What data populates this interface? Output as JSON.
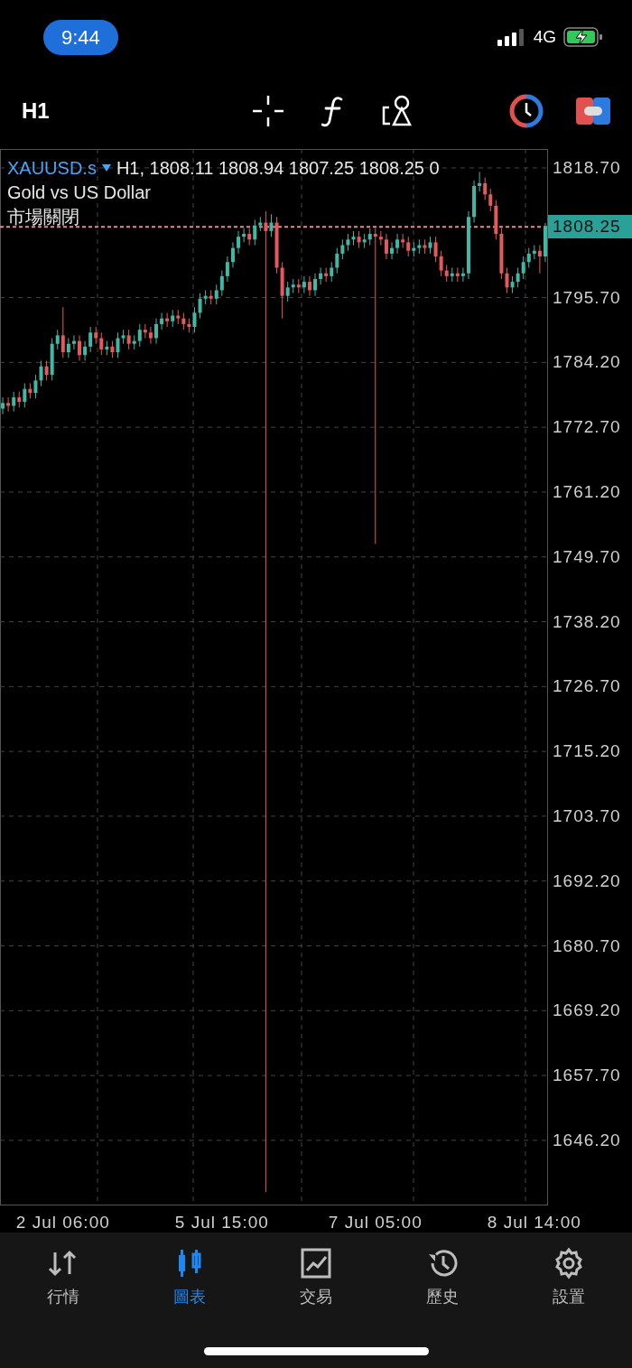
{
  "status_bar": {
    "time": "9:44",
    "network": "4G"
  },
  "toolbar": {
    "timeframe": "H1"
  },
  "chart": {
    "symbol": "XAUUSD.s",
    "quote": "H1, 1808.11 1808.94 1807.25 1808.25 0",
    "description": "Gold vs US Dollar",
    "market_status": "市場關閉",
    "chart_data": {
      "type": "candlestick",
      "categories": [
        null,
        null,
        null,
        null,
        null,
        null,
        null,
        null,
        null,
        null,
        null,
        "2 Jul 06:00",
        null,
        null,
        null,
        null,
        null,
        null,
        null,
        null,
        null,
        null,
        null,
        null,
        null,
        null,
        null,
        null,
        null,
        null,
        null,
        null,
        null,
        null,
        null,
        null,
        null,
        null,
        null,
        null,
        "5 Jul 15:00",
        null,
        null,
        null,
        null,
        null,
        null,
        null,
        null,
        null,
        null,
        null,
        null,
        null,
        null,
        null,
        null,
        null,
        null,
        null,
        null,
        null,
        null,
        null,
        null,
        null,
        null,
        null,
        "7 Jul 05:00",
        null,
        null,
        null,
        null,
        null,
        null,
        null,
        null,
        null,
        null,
        null,
        null,
        null,
        null,
        null,
        null,
        null,
        null,
        null,
        null,
        null,
        null,
        null,
        null,
        null,
        null,
        null,
        null,
        "8 Jul 14:00",
        null,
        null
      ],
      "grid": true,
      "ref_lines": [
        {
          "axis": "y",
          "value": 1808.25,
          "label": "1808.25"
        }
      ],
      "ohlc": [
        [
          1776.0,
          1778.0,
          1775.0,
          1777.0
        ],
        [
          1777.0,
          1778.0,
          1775.5,
          1776.5
        ],
        [
          1776.5,
          1779.0,
          1775.5,
          1778.0
        ],
        [
          1778.0,
          1779.0,
          1776.2,
          1777.2
        ],
        [
          1777.2,
          1780.5,
          1776.2,
          1779.5
        ],
        [
          1779.5,
          1780.5,
          1777.8,
          1778.8
        ],
        [
          1778.8,
          1782.0,
          1777.8,
          1781.0
        ],
        [
          1781.0,
          1784.5,
          1780.0,
          1783.5
        ],
        [
          1783.5,
          1784.5,
          1781.0,
          1782.0
        ],
        [
          1782.0,
          1788.5,
          1781.0,
          1787.5
        ],
        [
          1787.5,
          1790.0,
          1786.5,
          1789.0
        ],
        [
          1789.0,
          1794.0,
          1785.0,
          1786.0
        ],
        [
          1786.0,
          1788.5,
          1785.0,
          1787.5
        ],
        [
          1787.5,
          1789.0,
          1786.5,
          1788.0
        ],
        [
          1788.0,
          1789.0,
          1784.5,
          1785.5
        ],
        [
          1785.5,
          1788.0,
          1784.5,
          1787.0
        ],
        [
          1787.0,
          1790.5,
          1786.0,
          1789.5
        ],
        [
          1789.5,
          1790.5,
          1787.5,
          1788.5
        ],
        [
          1788.5,
          1789.5,
          1785.5,
          1786.5
        ],
        [
          1786.5,
          1788.0,
          1785.5,
          1787.0
        ],
        [
          1787.0,
          1788.0,
          1785.0,
          1786.0
        ],
        [
          1786.0,
          1789.5,
          1785.0,
          1788.5
        ],
        [
          1788.5,
          1790.0,
          1787.5,
          1789.0
        ],
        [
          1789.0,
          1790.0,
          1786.5,
          1787.5
        ],
        [
          1787.5,
          1789.0,
          1786.5,
          1788.0
        ],
        [
          1788.0,
          1791.0,
          1787.0,
          1790.0
        ],
        [
          1790.0,
          1791.0,
          1788.5,
          1789.5
        ],
        [
          1789.5,
          1790.5,
          1787.5,
          1788.5
        ],
        [
          1788.5,
          1792.0,
          1787.5,
          1791.0
        ],
        [
          1791.0,
          1793.0,
          1790.0,
          1792.0
        ],
        [
          1792.0,
          1793.0,
          1790.5,
          1791.5
        ],
        [
          1791.5,
          1793.5,
          1790.5,
          1792.5
        ],
        [
          1792.5,
          1793.5,
          1791.0,
          1792.0
        ],
        [
          1792.0,
          1793.0,
          1790.0,
          1791.0
        ],
        [
          1791.0,
          1792.0,
          1789.5,
          1790.5
        ],
        [
          1790.5,
          1794.0,
          1789.5,
          1793.0
        ],
        [
          1793.0,
          1796.5,
          1792.0,
          1795.5
        ],
        [
          1795.5,
          1797.0,
          1794.5,
          1796.0
        ],
        [
          1796.0,
          1797.0,
          1794.5,
          1795.5
        ],
        [
          1795.5,
          1798.0,
          1794.5,
          1797.0
        ],
        [
          1797.0,
          1800.5,
          1796.0,
          1799.5
        ],
        [
          1799.5,
          1803.0,
          1798.5,
          1802.0
        ],
        [
          1802.0,
          1805.5,
          1801.0,
          1804.5
        ],
        [
          1804.5,
          1807.5,
          1803.5,
          1806.5
        ],
        [
          1806.5,
          1808.0,
          1805.5,
          1807.0
        ],
        [
          1807.0,
          1808.0,
          1805.0,
          1806.0
        ],
        [
          1806.0,
          1809.5,
          1805.0,
          1808.5
        ],
        [
          1808.5,
          1810.0,
          1807.5,
          1809.0
        ],
        [
          1809.0,
          1811.0,
          1637.0,
          1807.5
        ],
        [
          1807.5,
          1810.5,
          1806.5,
          1809.0
        ],
        [
          1809.0,
          1810.0,
          1800.0,
          1801.0
        ],
        [
          1801.0,
          1802.0,
          1792.0,
          1796.0
        ],
        [
          1796.0,
          1798.5,
          1795.0,
          1797.5
        ],
        [
          1797.5,
          1799.0,
          1796.5,
          1798.0
        ],
        [
          1798.0,
          1799.0,
          1796.5,
          1797.5
        ],
        [
          1797.5,
          1799.5,
          1796.5,
          1798.5
        ],
        [
          1798.5,
          1799.5,
          1796.0,
          1797.0
        ],
        [
          1797.0,
          1800.0,
          1796.0,
          1799.0
        ],
        [
          1799.0,
          1801.0,
          1798.0,
          1800.0
        ],
        [
          1800.0,
          1801.0,
          1798.5,
          1799.5
        ],
        [
          1799.5,
          1802.0,
          1798.5,
          1801.0
        ],
        [
          1801.0,
          1804.5,
          1800.0,
          1803.5
        ],
        [
          1803.5,
          1806.0,
          1802.5,
          1805.0
        ],
        [
          1805.0,
          1807.0,
          1804.0,
          1806.0
        ],
        [
          1806.0,
          1807.5,
          1805.0,
          1806.5
        ],
        [
          1806.5,
          1807.5,
          1804.5,
          1805.5
        ],
        [
          1805.5,
          1807.0,
          1804.5,
          1806.0
        ],
        [
          1806.0,
          1808.0,
          1805.0,
          1807.0
        ],
        [
          1807.0,
          1808.0,
          1752.0,
          1806.5
        ],
        [
          1806.5,
          1807.5,
          1805.0,
          1806.0
        ],
        [
          1806.0,
          1807.0,
          1802.5,
          1803.5
        ],
        [
          1803.5,
          1805.5,
          1802.5,
          1804.5
        ],
        [
          1804.5,
          1807.0,
          1803.5,
          1806.0
        ],
        [
          1806.0,
          1807.0,
          1804.5,
          1805.5
        ],
        [
          1805.5,
          1806.5,
          1803.0,
          1804.0
        ],
        [
          1804.0,
          1805.5,
          1803.0,
          1804.5
        ],
        [
          1804.5,
          1806.0,
          1803.5,
          1805.0
        ],
        [
          1805.0,
          1806.0,
          1803.5,
          1804.5
        ],
        [
          1804.5,
          1806.5,
          1803.5,
          1805.5
        ],
        [
          1805.5,
          1806.5,
          1802.0,
          1803.0
        ],
        [
          1803.0,
          1804.0,
          1799.5,
          1800.5
        ],
        [
          1800.5,
          1801.5,
          1798.5,
          1799.5
        ],
        [
          1799.5,
          1801.0,
          1798.5,
          1800.0
        ],
        [
          1800.0,
          1801.0,
          1798.5,
          1799.5
        ],
        [
          1799.5,
          1801.0,
          1798.5,
          1800.0
        ],
        [
          1800.0,
          1811.0,
          1799.0,
          1810.0
        ],
        [
          1810.0,
          1816.5,
          1809.0,
          1815.5
        ],
        [
          1815.5,
          1818.0,
          1814.5,
          1816.0
        ],
        [
          1816.0,
          1817.0,
          1813.0,
          1814.0
        ],
        [
          1814.0,
          1815.0,
          1811.0,
          1812.0
        ],
        [
          1812.0,
          1813.0,
          1806.0,
          1807.0
        ],
        [
          1807.0,
          1808.0,
          1799.0,
          1800.0
        ],
        [
          1800.0,
          1801.0,
          1796.5,
          1797.5
        ],
        [
          1797.5,
          1799.5,
          1796.5,
          1798.5
        ],
        [
          1798.5,
          1801.0,
          1797.5,
          1800.0
        ],
        [
          1800.0,
          1803.0,
          1799.0,
          1802.0
        ],
        [
          1802.0,
          1804.5,
          1801.0,
          1803.5
        ],
        [
          1803.5,
          1805.0,
          1802.5,
          1804.0
        ],
        [
          1804.0,
          1805.0,
          1800.0,
          1803.0
        ],
        [
          1803.0,
          1808.94,
          1802.0,
          1808.25
        ]
      ],
      "ylim": [
        1634.65,
        1822.06
      ],
      "yticks": [
        {
          "value": 1818.7,
          "label": "1818.70"
        },
        {
          "value": 1795.7,
          "label": "1795.70"
        },
        {
          "value": 1784.2,
          "label": "1784.20"
        },
        {
          "value": 1772.7,
          "label": "1772.70"
        },
        {
          "value": 1761.2,
          "label": "1761.20"
        },
        {
          "value": 1749.7,
          "label": "1749.70"
        },
        {
          "value": 1738.2,
          "label": "1738.20"
        },
        {
          "value": 1726.7,
          "label": "1726.70"
        },
        {
          "value": 1715.2,
          "label": "1715.20"
        },
        {
          "value": 1703.7,
          "label": "1703.70"
        },
        {
          "value": 1692.2,
          "label": "1692.20"
        },
        {
          "value": 1680.7,
          "label": "1680.70"
        },
        {
          "value": 1669.2,
          "label": "1669.20"
        },
        {
          "value": 1657.7,
          "label": "1657.70"
        },
        {
          "value": 1646.2,
          "label": "1646.20"
        }
      ]
    }
  },
  "tab_bar": [
    {
      "label": "行情",
      "kind": "quotes",
      "selected": false
    },
    {
      "label": "圖表",
      "kind": "chart",
      "selected": true
    },
    {
      "label": "交易",
      "kind": "trade",
      "selected": false
    },
    {
      "label": "歷史",
      "kind": "history",
      "selected": false
    },
    {
      "label": "設置",
      "kind": "settings",
      "selected": false
    }
  ]
}
